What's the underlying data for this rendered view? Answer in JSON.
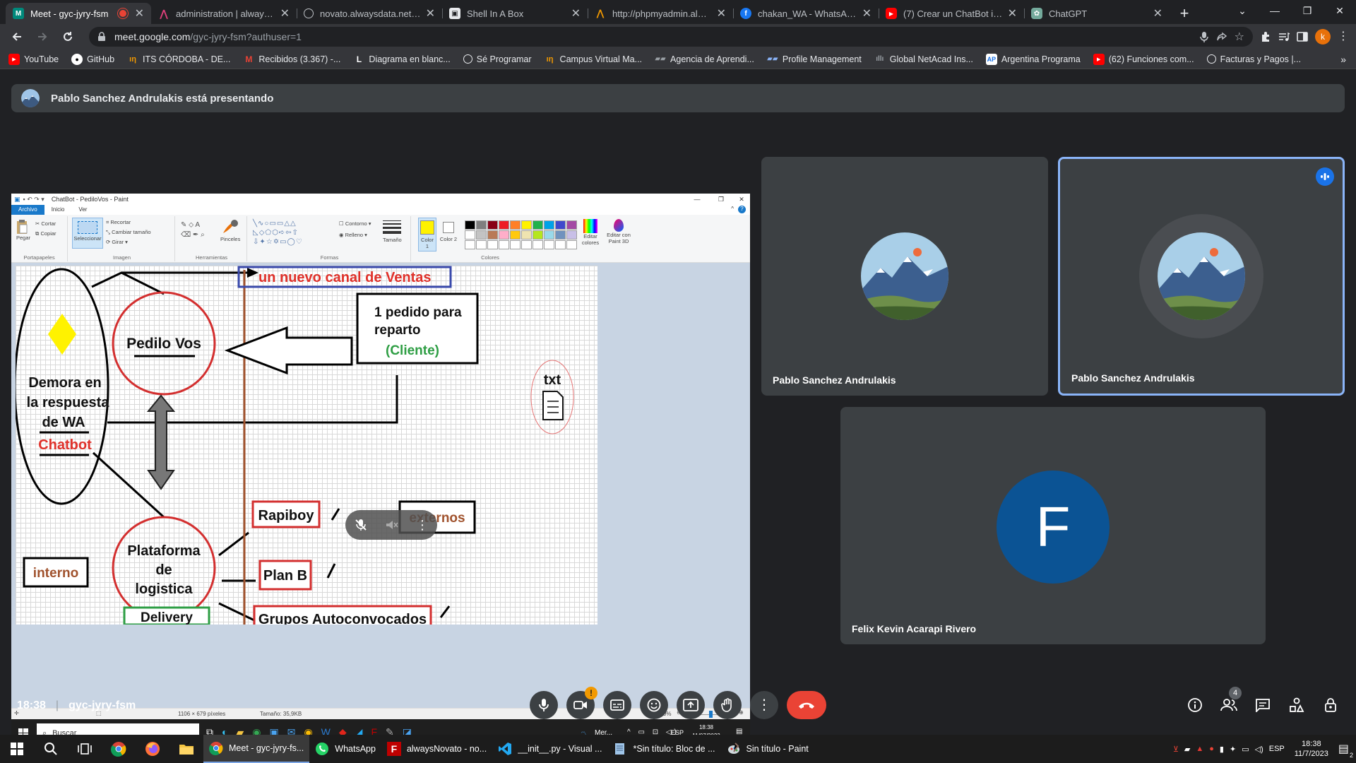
{
  "browser": {
    "tabs": [
      {
        "title": "Meet - gyc-jyry-fsm",
        "favicon": "meet",
        "active": true,
        "recording": true
      },
      {
        "title": "administration | alwaysdata",
        "favicon": "alwaysdata"
      },
      {
        "title": "novato.alwaysdata.net/wel",
        "favicon": "globe"
      },
      {
        "title": "Shell In A Box",
        "favicon": "shell"
      },
      {
        "title": "http://phpmyadmin.always",
        "favicon": "phpmyadmin"
      },
      {
        "title": "chakan_WA - WhatsApp - F",
        "favicon": "facebook"
      },
      {
        "title": "(7) Crear un ChatBot intelig",
        "favicon": "youtube"
      },
      {
        "title": "ChatGPT",
        "favicon": "chatgpt"
      }
    ],
    "url": {
      "host": "meet.google.com",
      "path": "/gyc-jyry-fsm?authuser=1"
    },
    "profile_initial": "k",
    "bookmarks": [
      {
        "label": "YouTube",
        "favicon": "youtube"
      },
      {
        "label": "GitHub",
        "favicon": "github"
      },
      {
        "label": "ITS CÓRDOBA - DE...",
        "favicon": "its"
      },
      {
        "label": "Recibidos (3.367) -...",
        "favicon": "gmail"
      },
      {
        "label": "Diagrama en blanc...",
        "favicon": "lucid"
      },
      {
        "label": "Sé Programar",
        "favicon": "globe"
      },
      {
        "label": "Campus Virtual Ma...",
        "favicon": "its"
      },
      {
        "label": "Agencia de Aprendi...",
        "favicon": "agencia"
      },
      {
        "label": "Profile Management",
        "favicon": "profile"
      },
      {
        "label": "Global NetAcad Ins...",
        "favicon": "cisco"
      },
      {
        "label": "Argentina Programa",
        "favicon": "argentina"
      },
      {
        "label": "(62) Funciones com...",
        "favicon": "youtube"
      },
      {
        "label": "Facturas y Pagos |...",
        "favicon": "globe"
      }
    ]
  },
  "meet": {
    "presenting_text": "Pablo Sanchez Andrulakis está presentando",
    "meeting_time": "18:38",
    "meeting_code": "gyc-jyry-fsm",
    "people_count": "4",
    "participants": [
      {
        "name": "Pablo Sanchez Andrulakis"
      },
      {
        "name": "Pablo Sanchez Andrulakis",
        "speaking": true
      },
      {
        "name": "Felix Kevin Acarapi Rivero",
        "initial": "F"
      }
    ],
    "colors": {
      "end_call": "#ea4335",
      "accent": "#8ab4f8",
      "avatar_f": "#0b5394"
    }
  },
  "paint": {
    "title": "ChatBot - PediloVos - Paint",
    "menu": [
      "Archivo",
      "Inicio",
      "Ver"
    ],
    "ribbon": {
      "portapapeles": {
        "caption": "Portapapeles",
        "pegar": "Pegar",
        "cortar": "Cortar",
        "copiar": "Copiar"
      },
      "imagen": {
        "caption": "Imagen",
        "seleccionar": "Seleccionar",
        "recortar": "Recortar",
        "cambiar": "Cambiar tamaño",
        "girar": "Girar"
      },
      "herramientas": {
        "caption": "Herramientas",
        "pinceles": "Pinceles"
      },
      "formas": {
        "caption": "Formas",
        "contorno": "Contorno",
        "relleno": "Relleno",
        "tamano": "Tamaño"
      },
      "colores": {
        "caption": "Colores",
        "color1": "Color 1",
        "color2": "Color 2",
        "editar": "Editar colores",
        "paint3d": "Editar con Paint 3D"
      }
    },
    "status": {
      "dimensions": "1106 × 679 píxeles",
      "size": "Tamaño: 35,9KB",
      "zoom": "100%"
    },
    "diagram": {
      "banner": "un nuevo canal de Ventas",
      "pedilo": "Pedilo Vos",
      "pedido_lines": [
        "1 pedido para",
        "reparto"
      ],
      "cliente": "(Cliente)",
      "demora_lines": [
        "Demora en",
        "la respuesta",
        "de WA"
      ],
      "chatbot": "Chatbot",
      "txt": "txt",
      "plataforma_lines": [
        "Plataforma",
        "de",
        "logistica"
      ],
      "rapiboy": "Rapiboy",
      "planb": "Plan B",
      "grupos": "Grupos Autoconvocados",
      "externos": "externos",
      "interno": "interno",
      "delivery": "Delivery"
    },
    "inner_taskbar": {
      "search": "Buscar",
      "weather": "Mer...",
      "lang": "ESP",
      "time": "18:38",
      "date": "11/07/2023"
    }
  },
  "taskbar": {
    "apps": [
      {
        "label": "Meet - gyc-jyry-fs...",
        "icon": "chrome",
        "active": true
      },
      {
        "label": "WhatsApp",
        "icon": "whatsapp"
      },
      {
        "label": "alwaysNovato - no...",
        "icon": "filezilla"
      },
      {
        "label": "__init__.py - Visual ...",
        "icon": "vscode"
      },
      {
        "label": "*Sin título: Bloc de ...",
        "icon": "notepad"
      },
      {
        "label": "Sin título - Paint",
        "icon": "paint"
      }
    ],
    "lang": "ESP",
    "time": "18:38",
    "date": "11/7/2023",
    "notifications": "2"
  }
}
